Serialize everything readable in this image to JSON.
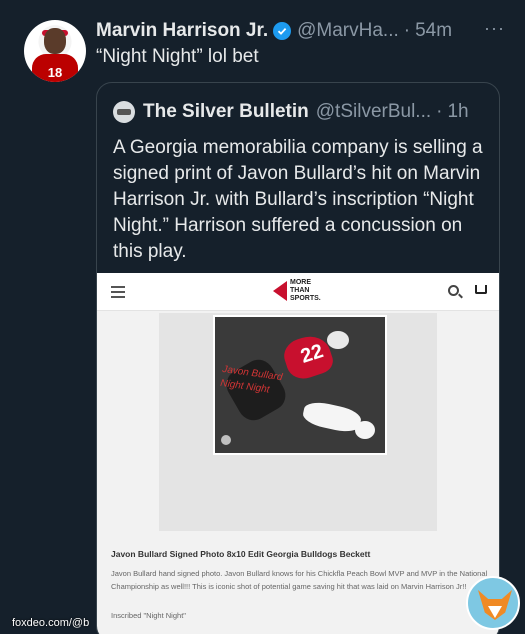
{
  "tweet": {
    "author_name": "Marvin Harrison Jr.",
    "handle": "@MarvHa...",
    "separator": "·",
    "time": "54m",
    "more": "···",
    "text": "“Night Night” lol bet",
    "avatar_jersey_number": "18"
  },
  "quote": {
    "author_name": "The Silver Bulletin",
    "handle": "@tSilverBul...",
    "separator": "·",
    "time": "1h",
    "text": "A Georgia memorabilia company is selling a signed print of Javon Bullard’s hit on Marvin Harrison Jr. with Bullard’s inscription “Night Night.” Harrison suffered a concussion on this play."
  },
  "webpage": {
    "logo_lines": [
      "MORE",
      "THAN",
      "SPORTS."
    ],
    "photo_jersey_number": "22",
    "signature_text": "Javon Bullard\nNight Night",
    "product_title": "Javon Bullard Signed Photo 8x10 Edit Georgia Bulldogs Beckett",
    "product_description": "Javon Bullard hand signed photo. Javon Bullard knows for his Chickfla Peach Bowl MVP and MVP in the National Championship as well!!! This is iconic shot of potential game saving hit that was laid on Marvin Harrison Jr!!",
    "inscription": "Inscribed \"Night Night\""
  },
  "overlay": {
    "watermark": "foxdeo.com/@b",
    "badge": "fox-mascot-icon"
  },
  "colors": {
    "background": "#15202b",
    "verified": "#1d9bf0",
    "muted_text": "#8b98a5"
  }
}
